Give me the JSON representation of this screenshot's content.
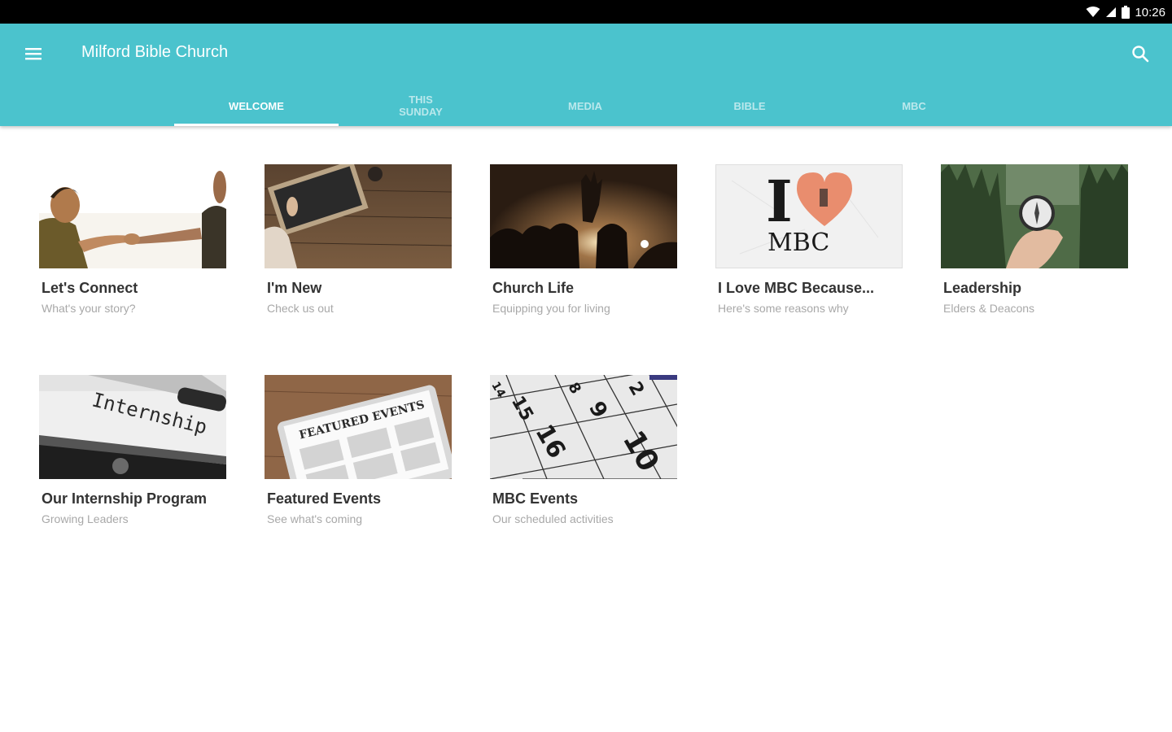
{
  "status_bar": {
    "time": "10:26",
    "icons": [
      "wifi-icon",
      "signal-icon",
      "battery-icon"
    ]
  },
  "app_bar": {
    "title": "Milford Bible Church",
    "menu_icon": "hamburger-menu-icon",
    "search_icon": "search-icon",
    "color": "#4bc3cd"
  },
  "tabs": [
    {
      "label": "WELCOME",
      "active": true
    },
    {
      "label": "THIS SUNDAY",
      "active": false
    },
    {
      "label": "MEDIA",
      "active": false
    },
    {
      "label": "BIBLE",
      "active": false
    },
    {
      "label": "MBC",
      "active": false
    }
  ],
  "cards": [
    {
      "title": "Let's Connect",
      "subtitle": "What's your story?"
    },
    {
      "title": "I'm New",
      "subtitle": "Check us out"
    },
    {
      "title": "Church Life",
      "subtitle": "Equipping you for living"
    },
    {
      "title": "I Love MBC Because...",
      "subtitle": "Here's some reasons why",
      "image_text": [
        "I",
        "MBC"
      ]
    },
    {
      "title": "Leadership",
      "subtitle": "Elders & Deacons"
    },
    {
      "title": "Our Internship Program",
      "subtitle": "Growing Leaders",
      "image_text": [
        "Internship"
      ]
    },
    {
      "title": "Featured Events",
      "subtitle": "See what's coming",
      "image_text": [
        "FEATURED EVENTS"
      ]
    },
    {
      "title": "MBC Events",
      "subtitle": "Our scheduled activities",
      "image_text": [
        "14",
        "15",
        "16",
        "8",
        "9",
        "10",
        "2"
      ]
    }
  ]
}
